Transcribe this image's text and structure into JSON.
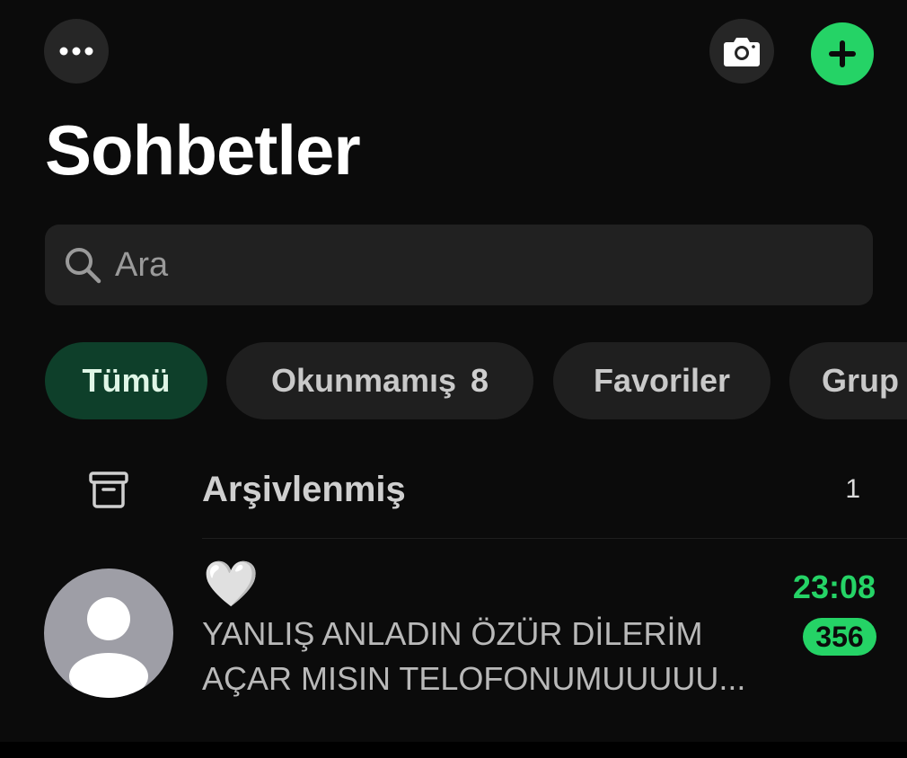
{
  "header": {
    "title": "Sohbetler",
    "more_icon": "more-dots-icon",
    "camera_icon": "camera-icon",
    "new_chat_icon": "plus-icon"
  },
  "search": {
    "placeholder": "Ara",
    "icon": "search-icon"
  },
  "filters": [
    {
      "label": "Tümü",
      "count": "",
      "active": true
    },
    {
      "label": "Okunmamış",
      "count": "8",
      "active": false
    },
    {
      "label": "Favoriler",
      "count": "",
      "active": false
    },
    {
      "label": "Grup",
      "count": "",
      "active": false
    }
  ],
  "archived": {
    "label": "Arşivlenmiş",
    "count": "1",
    "icon": "archive-box-icon"
  },
  "chats": [
    {
      "name": "🤍",
      "preview": "YANLIŞ ANLADIN ÖZÜR DİLERİM AÇAR MISIN TELOFONUMUUUUU...",
      "time": "23:08",
      "unread": "356",
      "avatar_icon": "default-avatar-icon"
    }
  ],
  "colors": {
    "accent": "#25d366",
    "active_chip_bg": "#0e3f2a",
    "background": "#0b0b0b"
  }
}
